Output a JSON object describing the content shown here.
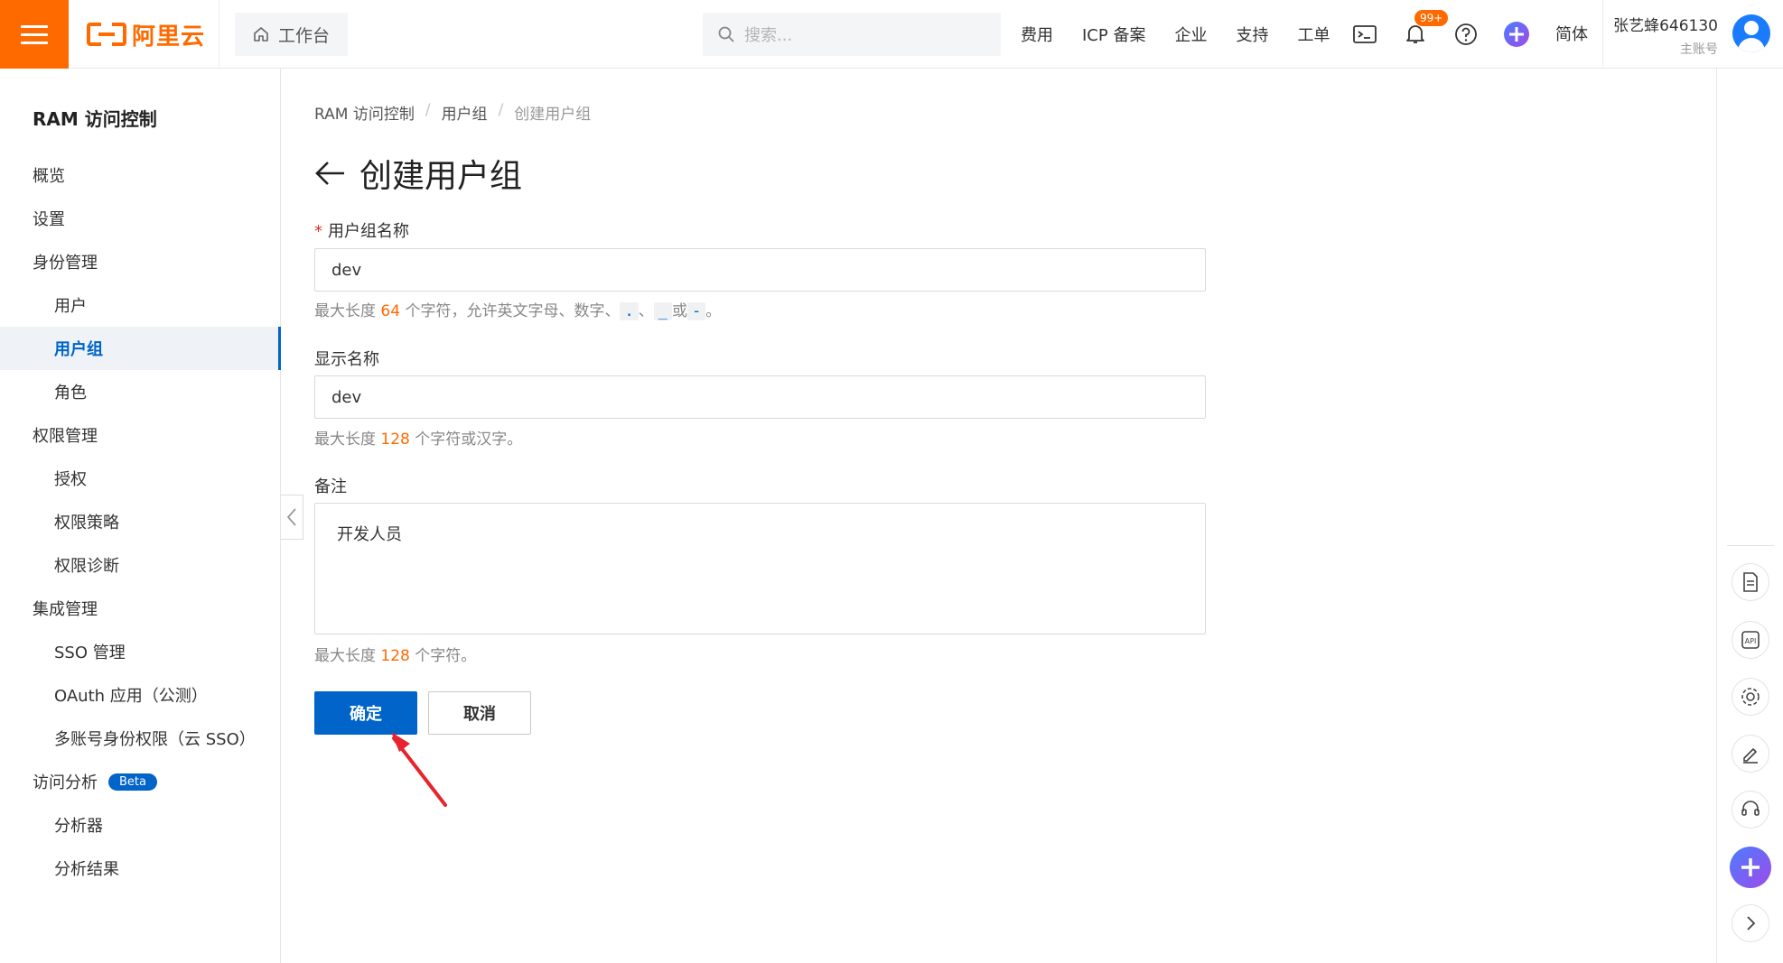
{
  "topbar": {
    "logo_text": "阿里云",
    "workbench_label": "工作台",
    "search_placeholder": "搜索...",
    "links": [
      "费用",
      "ICP 备案",
      "企业",
      "支持",
      "工单"
    ],
    "notification_badge": "99+",
    "language": "简体",
    "user_name": "张艺蜂646130",
    "user_role": "主账号"
  },
  "sidebar": {
    "title": "RAM 访问控制",
    "items": [
      {
        "label": "概览",
        "level": 1
      },
      {
        "label": "设置",
        "level": 1
      },
      {
        "label": "身份管理",
        "level": 1
      },
      {
        "label": "用户",
        "level": 2
      },
      {
        "label": "用户组",
        "level": 2,
        "active": true
      },
      {
        "label": "角色",
        "level": 2
      },
      {
        "label": "权限管理",
        "level": 1
      },
      {
        "label": "授权",
        "level": 2
      },
      {
        "label": "权限策略",
        "level": 2
      },
      {
        "label": "权限诊断",
        "level": 2
      },
      {
        "label": "集成管理",
        "level": 1
      },
      {
        "label": "SSO 管理",
        "level": 2
      },
      {
        "label": "OAuth 应用（公测）",
        "level": 2
      },
      {
        "label": "多账号身份权限（云 SSO）",
        "level": 2
      },
      {
        "label": "访问分析",
        "level": 1,
        "badge": "Beta"
      },
      {
        "label": "分析器",
        "level": 2
      },
      {
        "label": "分析结果",
        "level": 2
      }
    ]
  },
  "breadcrumb": [
    "RAM 访问控制",
    "用户组",
    "创建用户组"
  ],
  "page_title": "创建用户组",
  "form": {
    "group_name": {
      "label": "用户组名称",
      "value": "dev",
      "help_prefix": "最大长度 ",
      "help_num": "64",
      "help_mid": " 个字符，允许英文字母、数字、",
      "code1": ".",
      "sep1": "、",
      "code2": "_",
      "sep2": "或",
      "code3": "-",
      "help_end": "。"
    },
    "display_name": {
      "label": "显示名称",
      "value": "dev",
      "help_prefix": "最大长度 ",
      "help_num": "128",
      "help_suffix": " 个字符或汉字。"
    },
    "remark": {
      "label": "备注",
      "value": "开发人员",
      "help_prefix": "最大长度 ",
      "help_num": "128",
      "help_suffix": " 个字符。"
    },
    "confirm_label": "确定",
    "cancel_label": "取消"
  },
  "colors": {
    "brand_orange": "#ff6a00",
    "primary_blue": "#0064c8",
    "annotation_red": "#e8232d"
  }
}
